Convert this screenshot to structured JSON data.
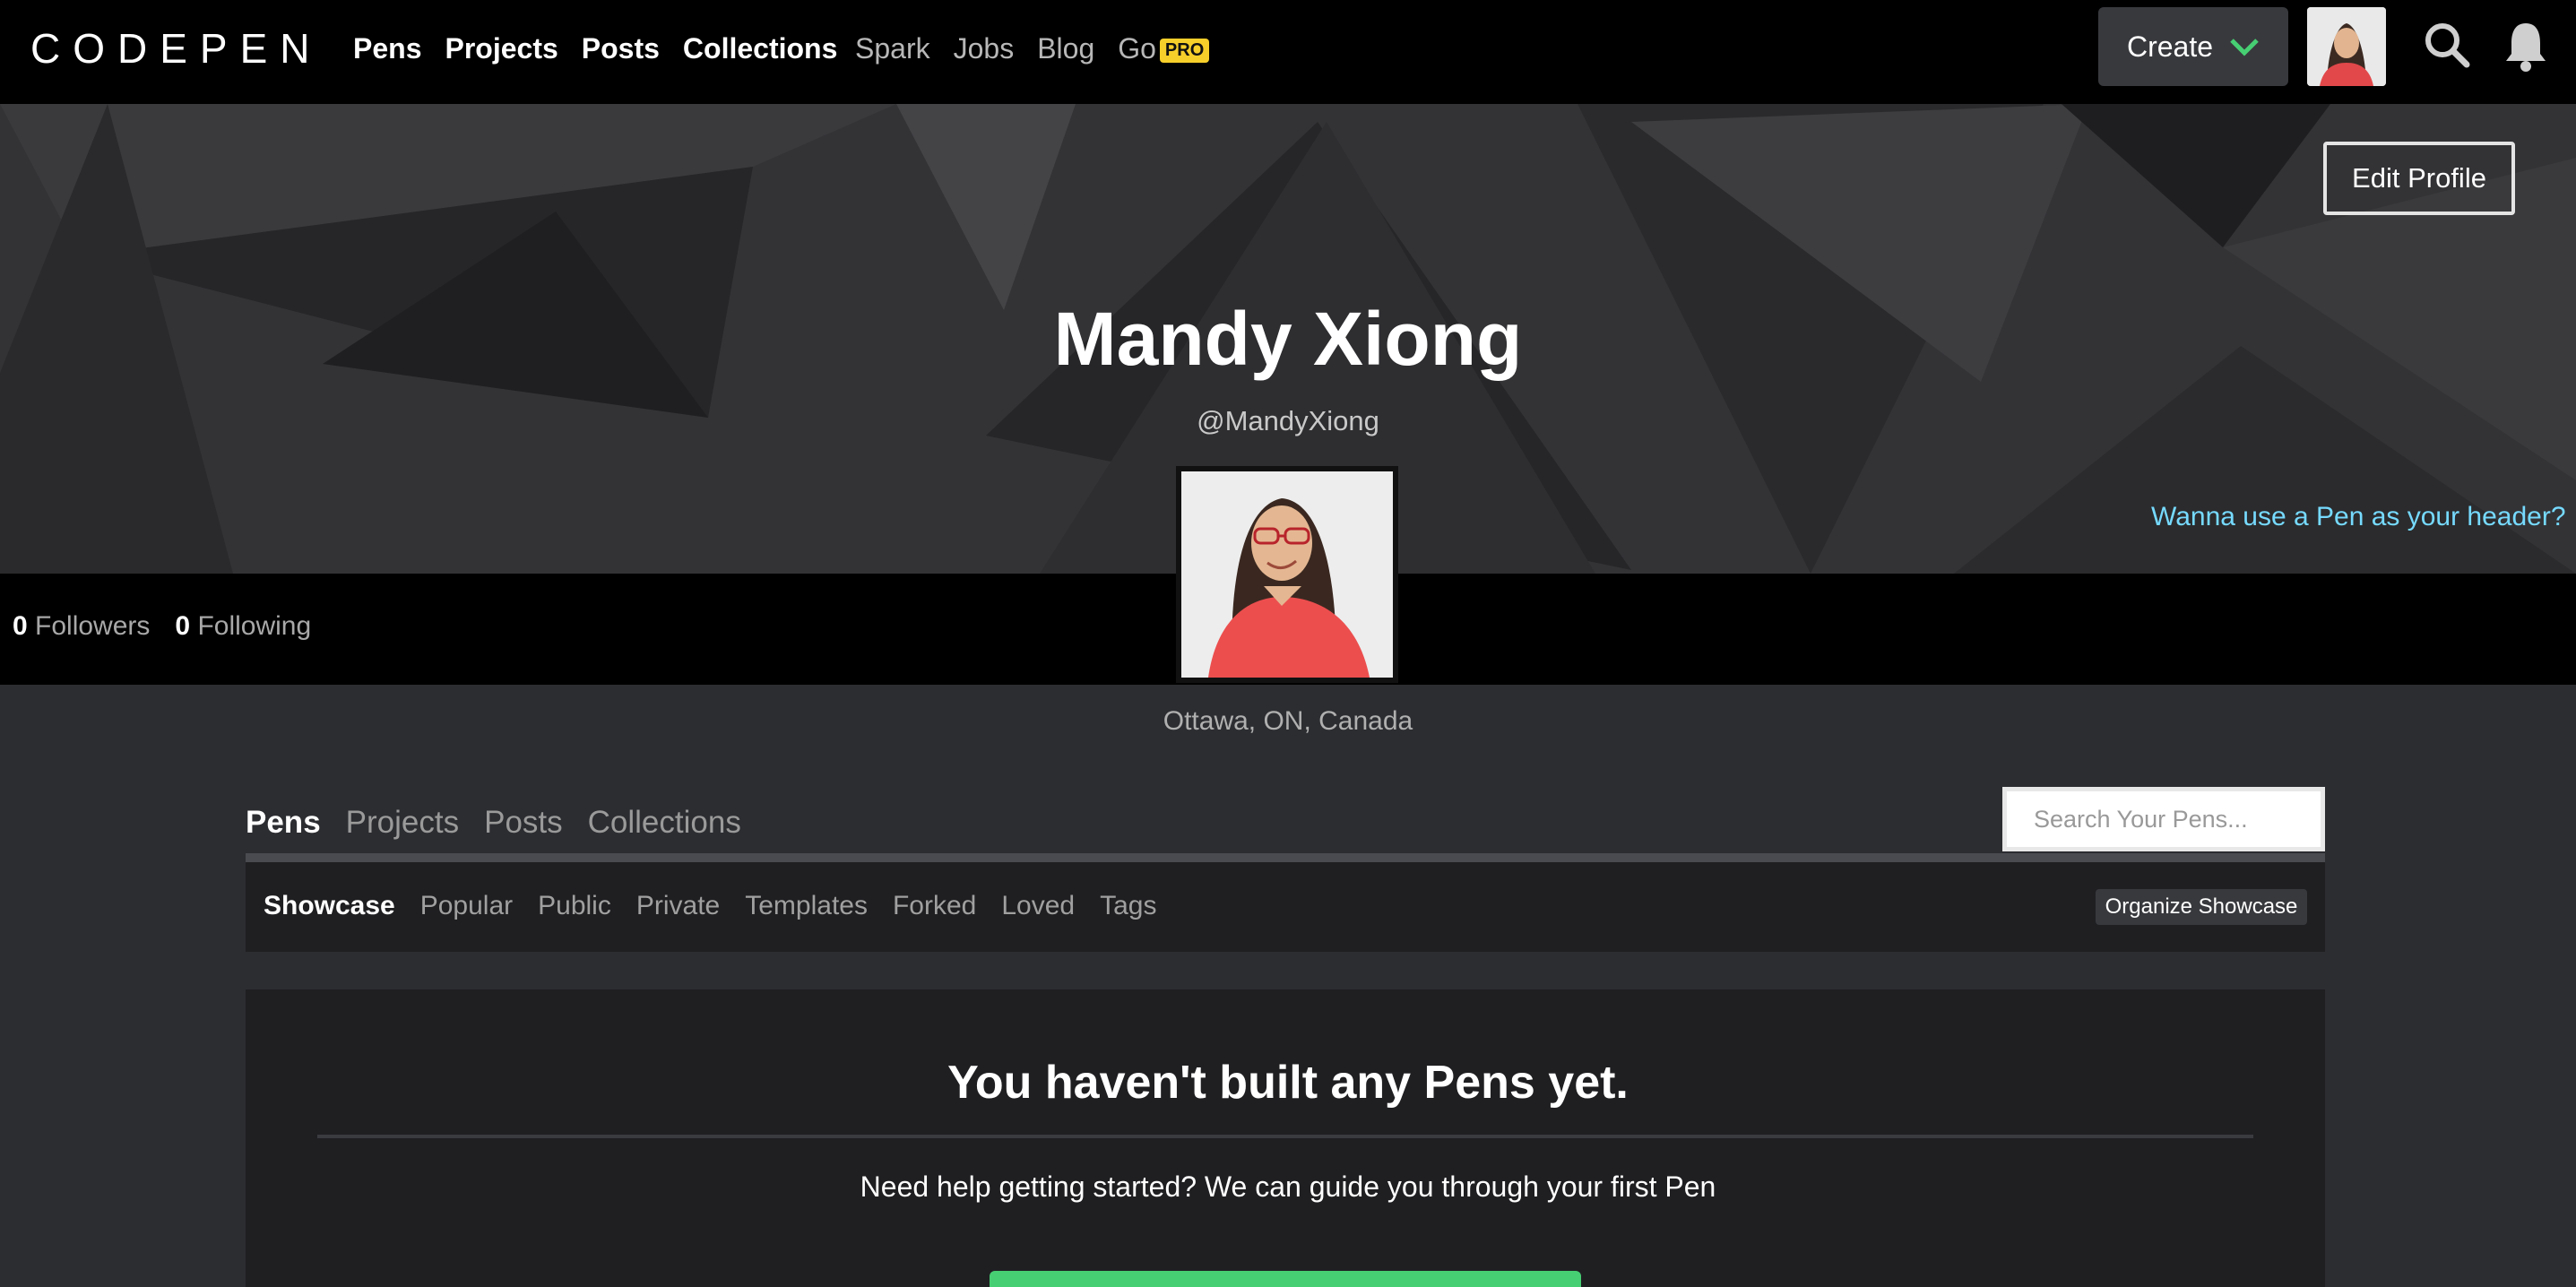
{
  "nav": {
    "logo_text": "CODEPEN",
    "main_links": [
      "Pens",
      "Projects",
      "Posts",
      "Collections"
    ],
    "secondary_links": [
      "Spark",
      "Jobs",
      "Blog",
      "Go"
    ],
    "pro_badge": "PRO",
    "create_label": "Create",
    "icons": [
      "codepen-logo-icon",
      "chevron-down-icon",
      "search-icon",
      "bell-icon"
    ],
    "accent_color": "#47cf73"
  },
  "profile": {
    "edit_label": "Edit Profile",
    "name": "Mandy Xiong",
    "handle": "@MandyXiong",
    "header_link": "Wanna use a Pen as your header?",
    "followers_count": "0",
    "followers_label": "Followers",
    "following_count": "0",
    "following_label": "Following",
    "location": "Ottawa, ON, Canada"
  },
  "tabs": {
    "items": [
      "Pens",
      "Projects",
      "Posts",
      "Collections"
    ],
    "active": "Pens",
    "search_placeholder": "Search Your Pens..."
  },
  "subtabs": {
    "items": [
      "Showcase",
      "Popular",
      "Public",
      "Private",
      "Templates",
      "Forked",
      "Loved",
      "Tags"
    ],
    "active": "Showcase",
    "organize_label": "Organize Showcase"
  },
  "empty_state": {
    "title": "You haven't built any Pens yet.",
    "subtitle": "Need help getting started? We can guide you through your first Pen"
  }
}
